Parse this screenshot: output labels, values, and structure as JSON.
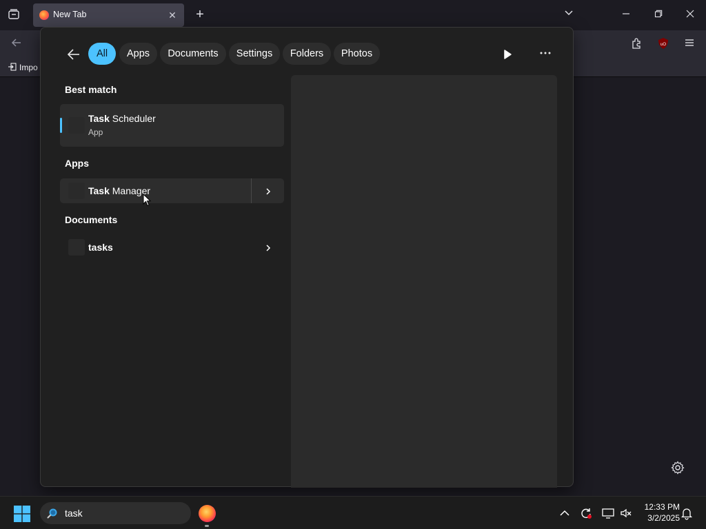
{
  "browser": {
    "tab_title": "New Tab",
    "bookmark_label": "Impo"
  },
  "search_panel": {
    "filters": [
      "All",
      "Apps",
      "Documents",
      "Settings",
      "Folders",
      "Photos"
    ],
    "active_filter": "All",
    "sections": {
      "best_match": {
        "heading": "Best match",
        "item": {
          "name_bold": "Task",
          "name_rest": " Scheduler",
          "type": "App"
        }
      },
      "apps": {
        "heading": "Apps",
        "item": {
          "name_bold": "Task",
          "name_rest": " Manager"
        }
      },
      "documents": {
        "heading": "Documents",
        "item": {
          "name_bold": "tasks",
          "name_rest": ""
        }
      }
    }
  },
  "taskbar": {
    "search_text": "task",
    "time": "12:33 PM",
    "date": "3/2/2025"
  },
  "colors": {
    "accent": "#4cc2ff",
    "panel_bg": "#202020",
    "taskbar_bg": "#1c1c1c"
  },
  "icons": [
    "back-arrow-icon",
    "play-icon",
    "more-icon",
    "chevron-right-icon",
    "gear-icon",
    "windows-logo-icon",
    "search-icon",
    "firefox-icon",
    "chevron-up-icon",
    "sync-icon",
    "display-icon",
    "speaker-muted-icon",
    "bell-icon"
  ]
}
